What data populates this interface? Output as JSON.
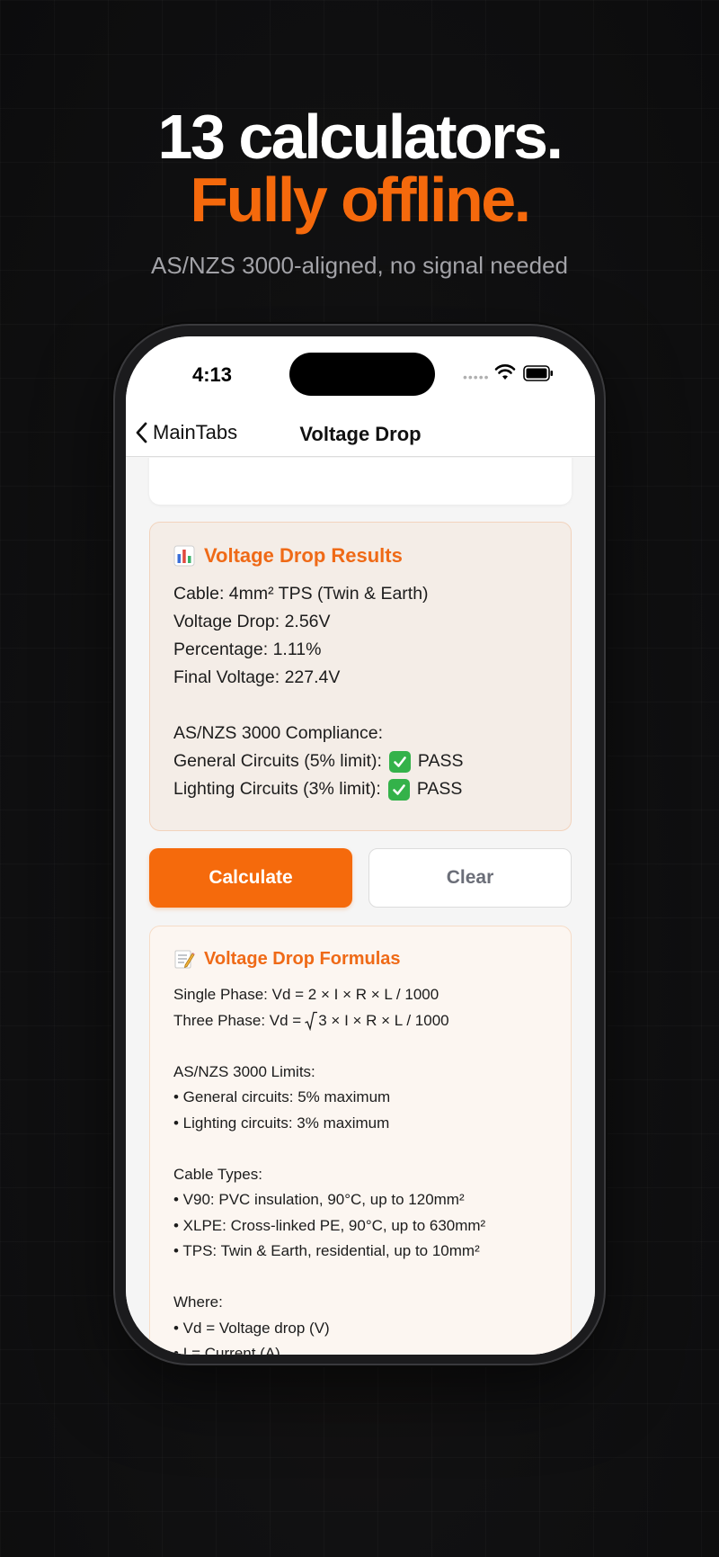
{
  "hero": {
    "line1": "13 calculators.",
    "line2": "Fully offline.",
    "subtitle": "AS/NZS 3000-aligned, no signal needed"
  },
  "status": {
    "time": "4:13",
    "dots": "•••••"
  },
  "nav": {
    "back_label": "MainTabs",
    "title": "Voltage Drop"
  },
  "results": {
    "title": "Voltage Drop Results",
    "icon": "bar-chart-icon",
    "lines": [
      "Cable: 4mm² TPS (Twin & Earth)",
      "Voltage Drop: 2.56V",
      "Percentage: 1.11%",
      "Final Voltage: 227.4V",
      "",
      "AS/NZS 3000 Compliance:"
    ],
    "checks": [
      {
        "label": "General Circuits (5% limit):",
        "result": "PASS"
      },
      {
        "label": "Lighting Circuits (3% limit):",
        "result": "PASS"
      }
    ]
  },
  "buttons": {
    "calculate": "Calculate",
    "clear": "Clear"
  },
  "formulas": {
    "title": "Voltage Drop Formulas",
    "icon": "memo-icon",
    "single_phase": "Single Phase: Vd = 2 × I × R × L / 1000",
    "three_phase_prefix": "Three Phase: Vd = ",
    "three_phase_rest": "3 × I × R × L / 1000",
    "lines": [
      "",
      "AS/NZS 3000 Limits:",
      "• General circuits: 5% maximum",
      "• Lighting circuits: 3% maximum",
      "",
      "Cable Types:",
      "• V90: PVC insulation, 90°C, up to 120mm²",
      "• XLPE: Cross-linked PE, 90°C, up to 630mm²",
      "• TPS: Twin & Earth, residential, up to 10mm²",
      "",
      "Where:",
      "• Vd = Voltage drop (V)",
      "• I = Current (A)"
    ]
  },
  "colors": {
    "accent": "#f56a0c",
    "pass": "#34b24a"
  }
}
